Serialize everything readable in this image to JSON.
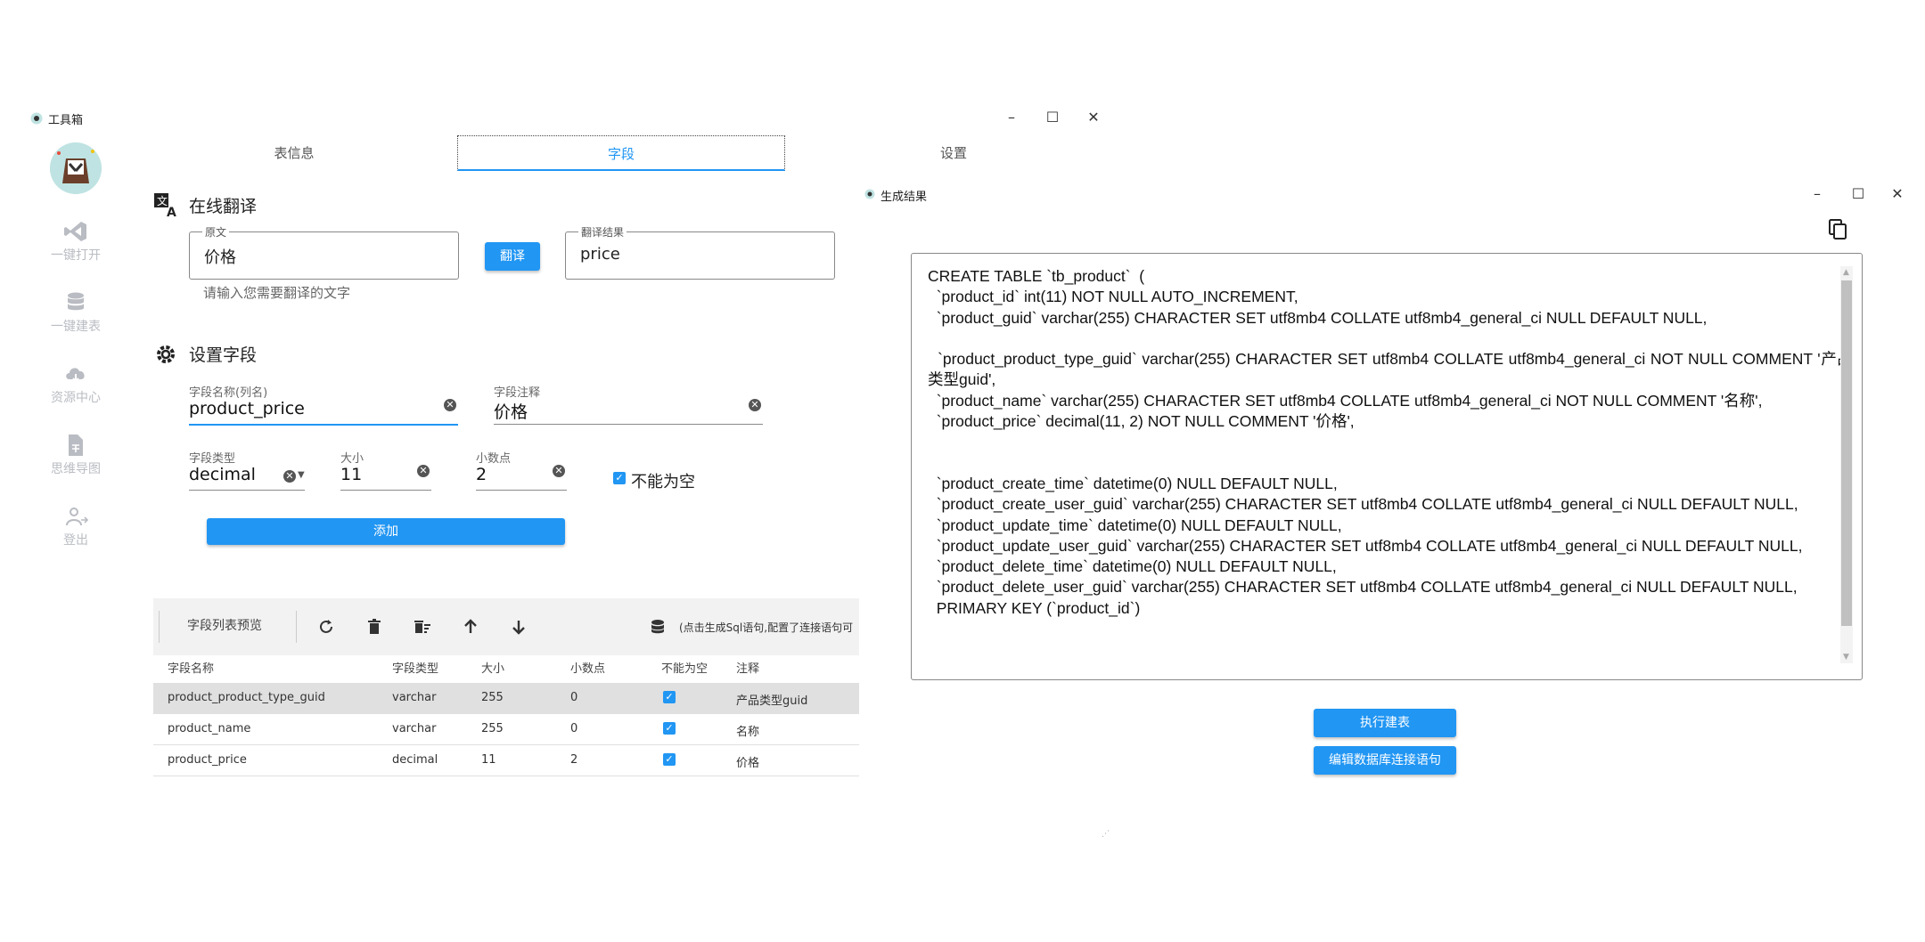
{
  "main_window": {
    "title": "工具箱",
    "controls": {
      "minimize": "–",
      "maximize": "☐",
      "close": "✕"
    }
  },
  "sidebar": {
    "items": [
      {
        "label": "一键打开",
        "icon": "vscode-icon"
      },
      {
        "label": "一键建表",
        "icon": "database-icon"
      },
      {
        "label": "资源中心",
        "icon": "cloud-download-icon"
      },
      {
        "label": "思维导图",
        "icon": "file-mindmap-icon"
      },
      {
        "label": "登出",
        "icon": "user-logout-icon"
      }
    ]
  },
  "tabs": [
    {
      "label": "表信息"
    },
    {
      "label": "字段",
      "active": true
    },
    {
      "label": "设置"
    }
  ],
  "translate": {
    "section_title": "在线翻译",
    "source_label": "原文",
    "source_value": "价格",
    "helper": "请输入您需要翻译的文字",
    "button": "翻译",
    "result_label": "翻译结果",
    "result_value": "price"
  },
  "field_setup": {
    "section_title": "设置字段",
    "name_label": "字段名称(列名)",
    "name_value": "product_price",
    "comment_label": "字段注释",
    "comment_value": "价格",
    "type_label": "字段类型",
    "type_value": "decimal",
    "size_label": "大小",
    "size_value": "11",
    "decimal_label": "小数点",
    "decimal_value": "2",
    "not_null_label": "不能为空",
    "not_null_checked": true,
    "add_button": "添加"
  },
  "field_list": {
    "title": "字段列表预览",
    "hint": "(点击生成Sql语句,配置了连接语句可",
    "columns": [
      "字段名称",
      "字段类型",
      "大小",
      "小数点",
      "不能为空",
      "注释"
    ],
    "rows": [
      {
        "name": "product_product_type_guid",
        "type": "varchar",
        "size": "255",
        "decimal": "0",
        "not_null": true,
        "comment": "产品类型guid"
      },
      {
        "name": "product_name",
        "type": "varchar",
        "size": "255",
        "decimal": "0",
        "not_null": true,
        "comment": "名称"
      },
      {
        "name": "product_price",
        "type": "decimal",
        "size": "11",
        "decimal": "2",
        "not_null": true,
        "comment": "价格"
      }
    ]
  },
  "result_window": {
    "title": "生成结果",
    "sql": "CREATE TABLE `tb_product`  (\n  `product_id` int(11) NOT NULL AUTO_INCREMENT,\n  `product_guid` varchar(255) CHARACTER SET utf8mb4 COLLATE utf8mb4_general_ci NULL DEFAULT NULL,\n\n  `product_product_type_guid` varchar(255) CHARACTER SET utf8mb4 COLLATE utf8mb4_general_ci NOT NULL COMMENT '产品类型guid',\n  `product_name` varchar(255) CHARACTER SET utf8mb4 COLLATE utf8mb4_general_ci NOT NULL COMMENT '名称',\n  `product_price` decimal(11, 2) NOT NULL COMMENT '价格',\n\n\n  `product_create_time` datetime(0) NULL DEFAULT NULL,\n  `product_create_user_guid` varchar(255) CHARACTER SET utf8mb4 COLLATE utf8mb4_general_ci NULL DEFAULT NULL,\n  `product_update_time` datetime(0) NULL DEFAULT NULL,\n  `product_update_user_guid` varchar(255) CHARACTER SET utf8mb4 COLLATE utf8mb4_general_ci NULL DEFAULT NULL,\n  `product_delete_time` datetime(0) NULL DEFAULT NULL,\n  `product_delete_user_guid` varchar(255) CHARACTER SET utf8mb4 COLLATE utf8mb4_general_ci NULL DEFAULT NULL,\n  PRIMARY KEY (`product_id`)",
    "execute_button": "执行建表",
    "edit_button": "编辑数据库连接语句"
  },
  "colors": {
    "accent": "#2196f3",
    "sidebar_icon": "#b9bcc2",
    "toolbar_bg": "#f2f2f2",
    "selected_row": "#e0e0e0"
  }
}
